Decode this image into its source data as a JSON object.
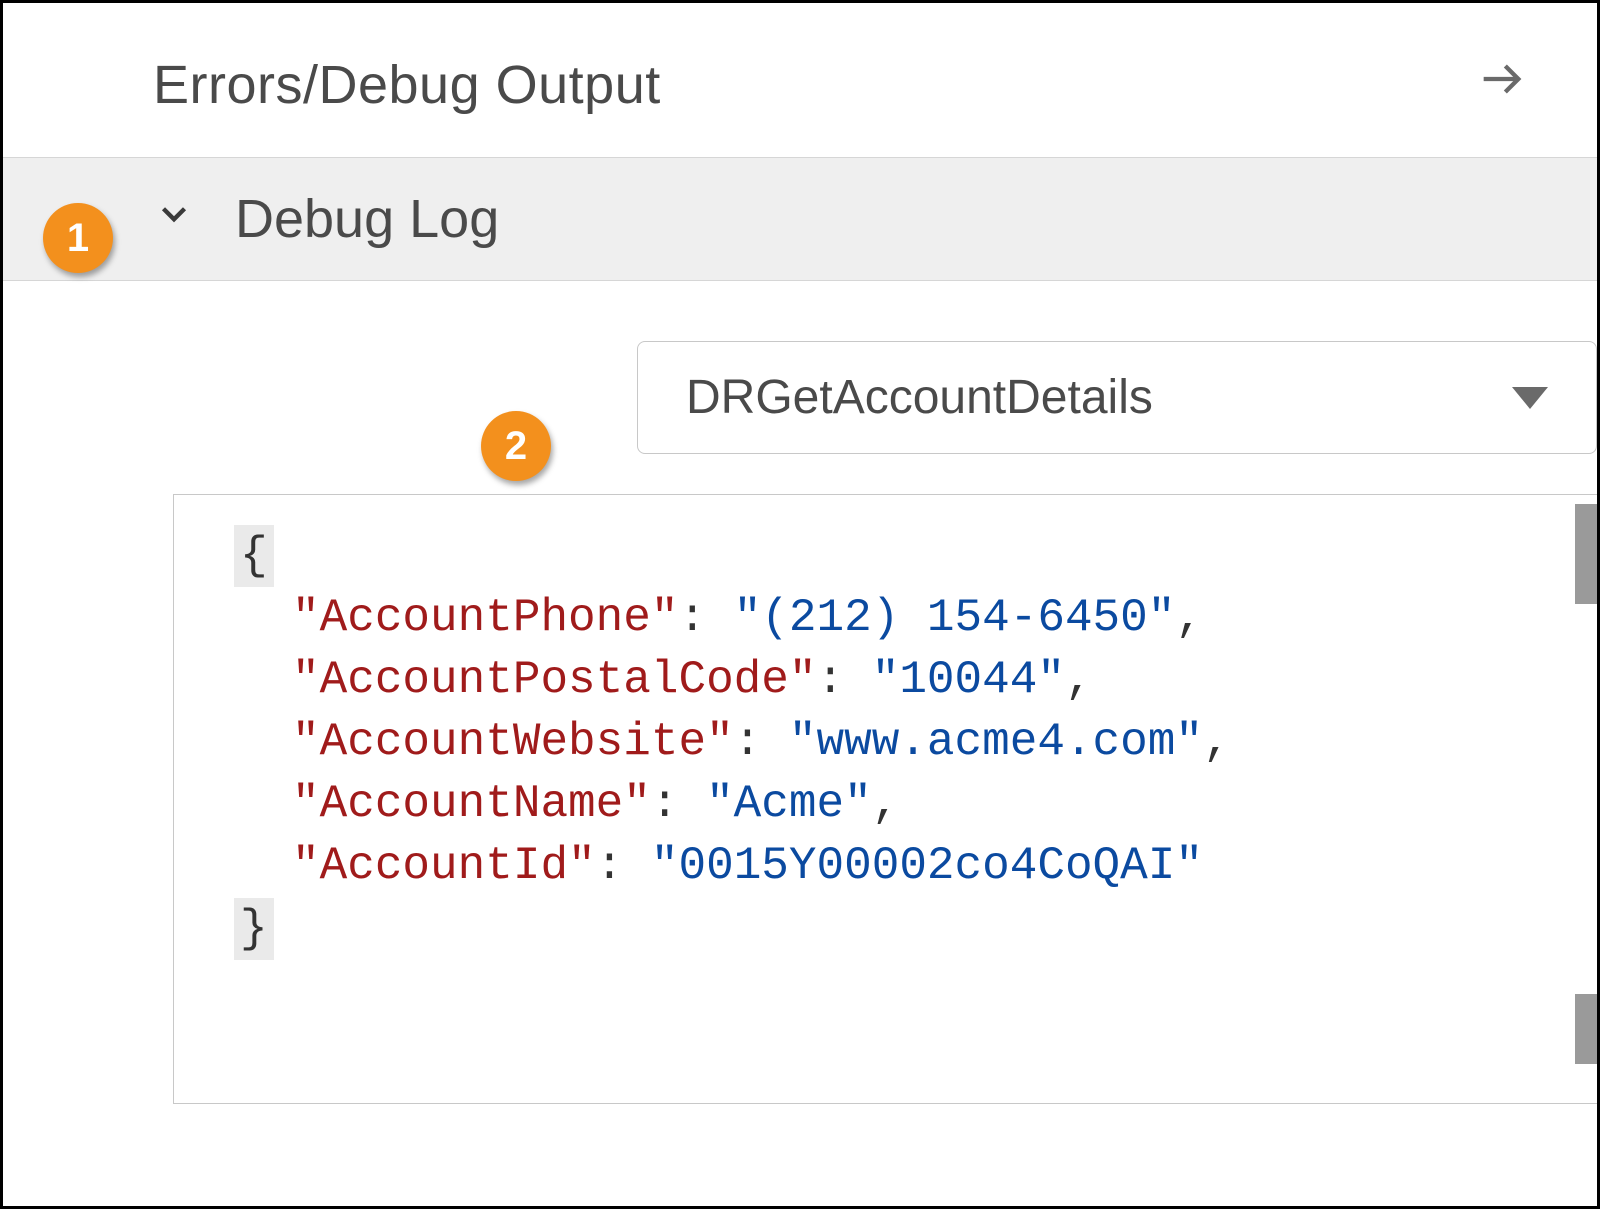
{
  "panel": {
    "title": "Errors/Debug Output"
  },
  "section": {
    "title": "Debug Log"
  },
  "dropdown": {
    "selected": "DRGetAccountDetails"
  },
  "callouts": {
    "one": "1",
    "two": "2"
  },
  "json_output": {
    "open_brace": "{",
    "close_brace": "}",
    "entries": [
      {
        "key": "\"AccountPhone\"",
        "value": "\"(212) 154-6450\"",
        "comma": ","
      },
      {
        "key": "\"AccountPostalCode\"",
        "value": "\"10044\"",
        "comma": ","
      },
      {
        "key": "\"AccountWebsite\"",
        "value": "\"www.acme4.com\"",
        "comma": ","
      },
      {
        "key": "\"AccountName\"",
        "value": "\"Acme\"",
        "comma": ","
      },
      {
        "key": "\"AccountId\"",
        "value": "\"0015Y00002co4CoQAI\"",
        "comma": ""
      }
    ]
  }
}
